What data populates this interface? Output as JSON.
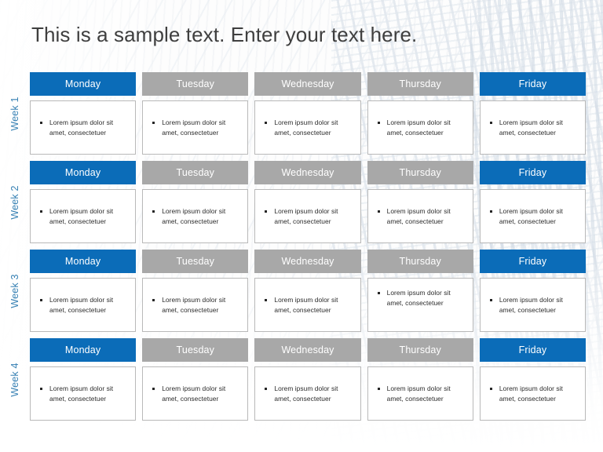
{
  "slide": {
    "title": "This is a sample text. Enter your text here.",
    "background_style": "faint-skyscraper-watermark"
  },
  "colors": {
    "accent_blue": "#0b6cb8",
    "muted_gray": "#a8a8a8",
    "week_label_blue": "#3680b3",
    "title_text": "#3f3f3f",
    "card_border": "#b9b9b9",
    "card_background": "#ffffff",
    "bullet_text": "#2b2b2b"
  },
  "planner": {
    "day_columns": [
      {
        "label": "Monday",
        "style": "accent"
      },
      {
        "label": "Tuesday",
        "style": "muted"
      },
      {
        "label": "Wednesday",
        "style": "muted"
      },
      {
        "label": "Thursday",
        "style": "muted"
      },
      {
        "label": "Friday",
        "style": "accent"
      }
    ],
    "weeks": [
      {
        "label": "Week 1",
        "cells": [
          {
            "bullet": "Lorem  ipsum dolor sit amet, consectetuer"
          },
          {
            "bullet": "Lorem  ipsum dolor sit amet, consectetuer"
          },
          {
            "bullet": "Lorem  ipsum dolor sit amet, consectetuer"
          },
          {
            "bullet": "Lorem  ipsum dolor sit amet, consectetuer"
          },
          {
            "bullet": "Lorem  ipsum dolor sit amet, consectetuer"
          }
        ]
      },
      {
        "label": "Week 2",
        "cells": [
          {
            "bullet": "Lorem  ipsum dolor sit amet, consectetuer"
          },
          {
            "bullet": "Lorem  ipsum dolor sit amet, consectetuer"
          },
          {
            "bullet": "Lorem  ipsum dolor sit amet, consectetuer"
          },
          {
            "bullet": "Lorem  ipsum dolor sit amet, consectetuer"
          },
          {
            "bullet": "Lorem  ipsum dolor sit amet, consectetuer"
          }
        ]
      },
      {
        "label": "Week 3",
        "cells": [
          {
            "bullet": "Lorem  ipsum dolor sit amet, consectetuer"
          },
          {
            "bullet": "Lorem  ipsum dolor sit amet, consectetuer"
          },
          {
            "bullet": "Lorem  ipsum dolor sit amet, consectetuer"
          },
          {
            "bullet": "Lorem  ipsum dolor sit amet, consectetuer"
          },
          {
            "bullet": "Lorem  ipsum dolor sit amet, consectetuer"
          }
        ]
      },
      {
        "label": "Week 4",
        "cells": [
          {
            "bullet": "Lorem  ipsum dolor sit amet, consectetuer"
          },
          {
            "bullet": "Lorem  ipsum dolor sit amet, consectetuer"
          },
          {
            "bullet": "Lorem  ipsum dolor sit amet, consectetuer"
          },
          {
            "bullet": "Lorem  ipsum dolor sit amet, consectetuer"
          },
          {
            "bullet": "Lorem  ipsum dolor sit amet, consectetuer"
          }
        ]
      }
    ]
  }
}
